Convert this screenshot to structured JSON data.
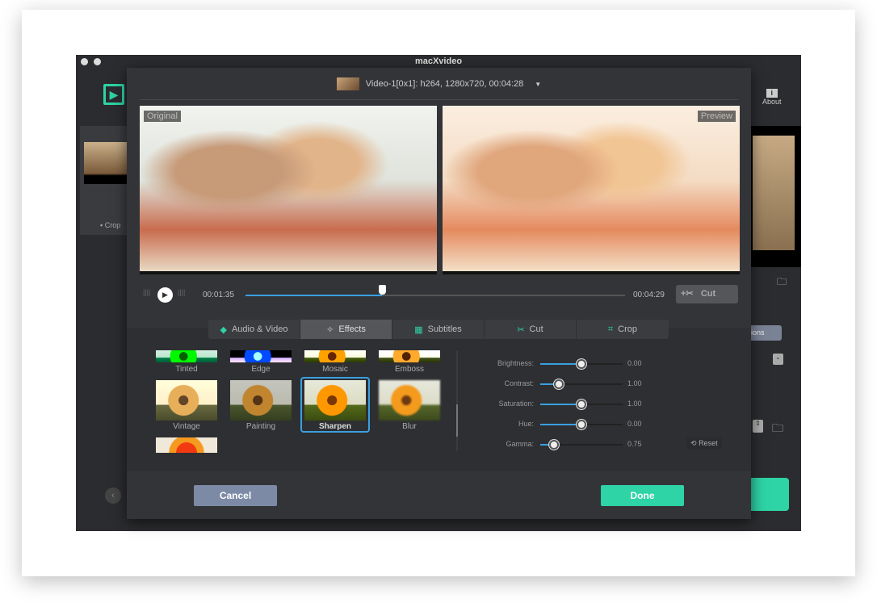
{
  "window": {
    "title": "macXvideo"
  },
  "toolbar": {
    "about_label": "About"
  },
  "background": {
    "crop_label": "Crop",
    "options_label": "ions"
  },
  "modal": {
    "video_selector": "Video-1[0x1]: h264, 1280x720, 00:04:28",
    "original_label": "Original",
    "preview_label": "Preview",
    "playback": {
      "current_time": "00:01:35",
      "total_time": "00:04:29",
      "progress": 0.36,
      "cut_label": "Cut"
    },
    "tabs": [
      {
        "label": "Audio & Video"
      },
      {
        "label": "Effects",
        "active": true
      },
      {
        "label": "Subtitles"
      },
      {
        "label": "Cut"
      },
      {
        "label": "Crop"
      }
    ],
    "effects": [
      {
        "label": "Tinted"
      },
      {
        "label": "Edge"
      },
      {
        "label": "Mosaic"
      },
      {
        "label": "Emboss"
      },
      {
        "label": "Vintage"
      },
      {
        "label": "Painting"
      },
      {
        "label": "Sharpen",
        "selected": true
      },
      {
        "label": "Blur"
      }
    ],
    "adjustments": [
      {
        "label": "Brightness:",
        "value": "0.00",
        "level": 0.5
      },
      {
        "label": "Contrast:",
        "value": "1.00",
        "level": 0.23
      },
      {
        "label": "Saturation:",
        "value": "1.00",
        "level": 0.5
      },
      {
        "label": "Hue:",
        "value": "0.00",
        "level": 0.5
      },
      {
        "label": "Gamma:",
        "value": "0.75",
        "level": 0.17
      }
    ],
    "reset_label": "Reset",
    "cancel_label": "Cancel",
    "done_label": "Done"
  },
  "colors": {
    "accent": "#2ed3a6",
    "blue": "#3aa0e0",
    "cancel": "#7c8aa6"
  }
}
